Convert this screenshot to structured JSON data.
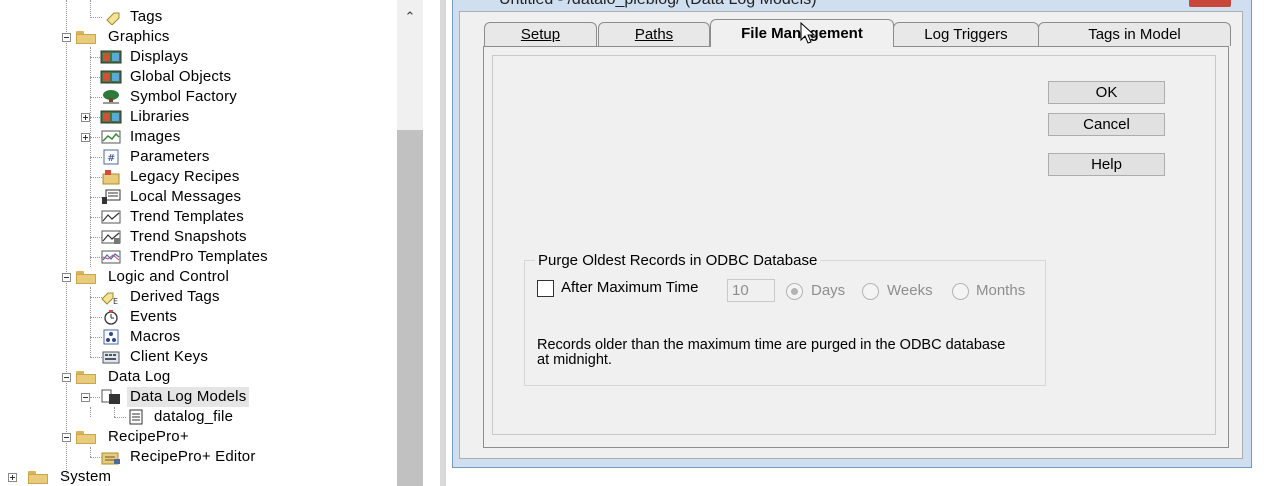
{
  "tree": {
    "items": [
      {
        "label": "Tags",
        "icon": "tag-icon"
      },
      {
        "label": "Graphics",
        "icon": "folder-icon"
      },
      {
        "label": "Displays",
        "icon": "display-icon"
      },
      {
        "label": "Global Objects",
        "icon": "global-objects-icon"
      },
      {
        "label": "Symbol Factory",
        "icon": "symbol-factory-icon"
      },
      {
        "label": "Libraries",
        "icon": "libraries-icon"
      },
      {
        "label": "Images",
        "icon": "images-icon"
      },
      {
        "label": "Parameters",
        "icon": "parameters-icon"
      },
      {
        "label": "Legacy Recipes",
        "icon": "legacy-recipes-icon"
      },
      {
        "label": "Local Messages",
        "icon": "local-messages-icon"
      },
      {
        "label": "Trend Templates",
        "icon": "trend-templates-icon"
      },
      {
        "label": "Trend Snapshots",
        "icon": "trend-snapshots-icon"
      },
      {
        "label": "TrendPro Templates",
        "icon": "trendpro-templates-icon"
      },
      {
        "label": "Logic and Control",
        "icon": "folder-icon"
      },
      {
        "label": "Derived Tags",
        "icon": "derived-tags-icon"
      },
      {
        "label": "Events",
        "icon": "events-icon"
      },
      {
        "label": "Macros",
        "icon": "macros-icon"
      },
      {
        "label": "Client Keys",
        "icon": "client-keys-icon"
      },
      {
        "label": "Data Log",
        "icon": "folder-icon"
      },
      {
        "label": "Data Log Models",
        "icon": "data-log-models-icon"
      },
      {
        "label": "datalog_file",
        "icon": "document-icon"
      },
      {
        "label": "RecipePro+",
        "icon": "folder-icon"
      },
      {
        "label": "RecipePro+ Editor",
        "icon": "recipepro-editor-icon"
      },
      {
        "label": "System",
        "icon": "folder-icon"
      }
    ]
  },
  "dialog": {
    "title": "Untitled - /datalo_pieblog/ (Data Log Models)",
    "tabs": [
      "Setup",
      "Paths",
      "File Management",
      "Log Triggers",
      "Tags in Model"
    ],
    "active_tab": "File Management",
    "buttons": {
      "ok": "OK",
      "cancel": "Cancel",
      "help": "Help"
    },
    "purge_group": {
      "title": "Purge Oldest Records in ODBC Database",
      "checkbox_label": "After Maximum Time",
      "checkbox_checked": false,
      "time_value": "10",
      "units": [
        "Days",
        "Weeks",
        "Months"
      ],
      "selected_unit": "Days",
      "note": "Records older than the maximum time are purged in the ODBC database at midnight."
    }
  },
  "colors": {
    "dialog_frame": "#cfdff0",
    "close_button": "#c8463a",
    "client_bg": "#f0f0f0"
  }
}
